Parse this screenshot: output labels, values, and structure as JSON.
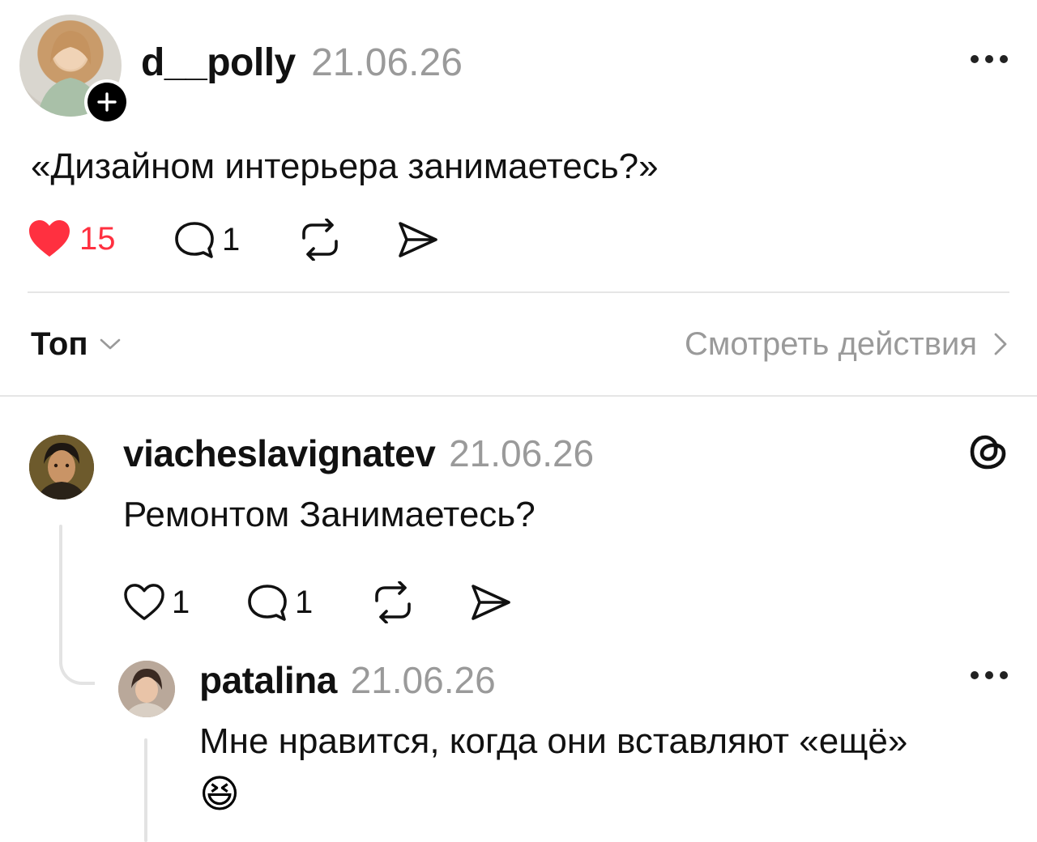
{
  "post": {
    "username": "d__polly",
    "date": "21.06.26",
    "text": "«Дизайном интерьера занимаетесь?»",
    "likes": "15",
    "comments": "1",
    "liked": true
  },
  "sort": {
    "label": "Топ",
    "view_activity": "Смотреть действия"
  },
  "replies": [
    {
      "username": "viacheslavignatev",
      "date": "21.06.26",
      "text": "Ремонтом Занимаетесь?",
      "likes": "1",
      "comments": "1"
    },
    {
      "username": "patalina",
      "date": "21.06.26",
      "text": "Мне нравится, когда они вставляют «ещё»",
      "emoji": "😆"
    }
  ],
  "colors": {
    "like_red": "#ff3040",
    "muted": "#9a9a9a",
    "divider": "#e6e6e6"
  },
  "icons": [
    "plus-icon",
    "more-icon",
    "heart-icon",
    "comment-icon",
    "repost-icon",
    "share-icon",
    "chevron-down-icon",
    "chevron-right-icon",
    "threads-logo-icon"
  ]
}
